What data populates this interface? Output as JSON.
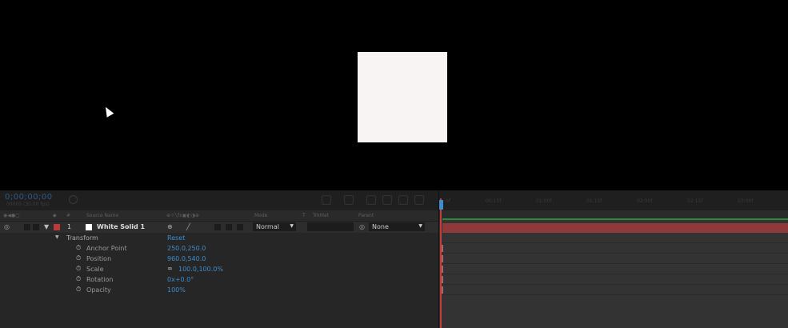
{
  "header": {
    "timecode": "0;00;00;00",
    "fps": "00000 (30.00 fps)",
    "ruler_ticks": [
      "0f",
      "00:15f",
      "01:00f",
      "01:15f",
      "02:00f",
      "02:15f",
      "03:00f"
    ]
  },
  "columns": {
    "source_name": "Source Name",
    "number": "#",
    "mode": "Mode",
    "t": "T",
    "trkmat": "TrkMat",
    "parent": "Parent"
  },
  "layer": {
    "number": "1",
    "name": "White Solid 1",
    "mode": "Normal",
    "parent": "None",
    "label_color": "#b83a3a"
  },
  "transform": {
    "label": "Transform",
    "reset": "Reset",
    "properties": [
      {
        "name": "Anchor Point",
        "value": "250.0,250.0"
      },
      {
        "name": "Position",
        "value": "960.0,540.0"
      },
      {
        "name": "Scale",
        "value": "100.0,100.0%"
      },
      {
        "name": "Rotation",
        "value": "0x+0.0°"
      },
      {
        "name": "Opacity",
        "value": "100%"
      }
    ]
  }
}
